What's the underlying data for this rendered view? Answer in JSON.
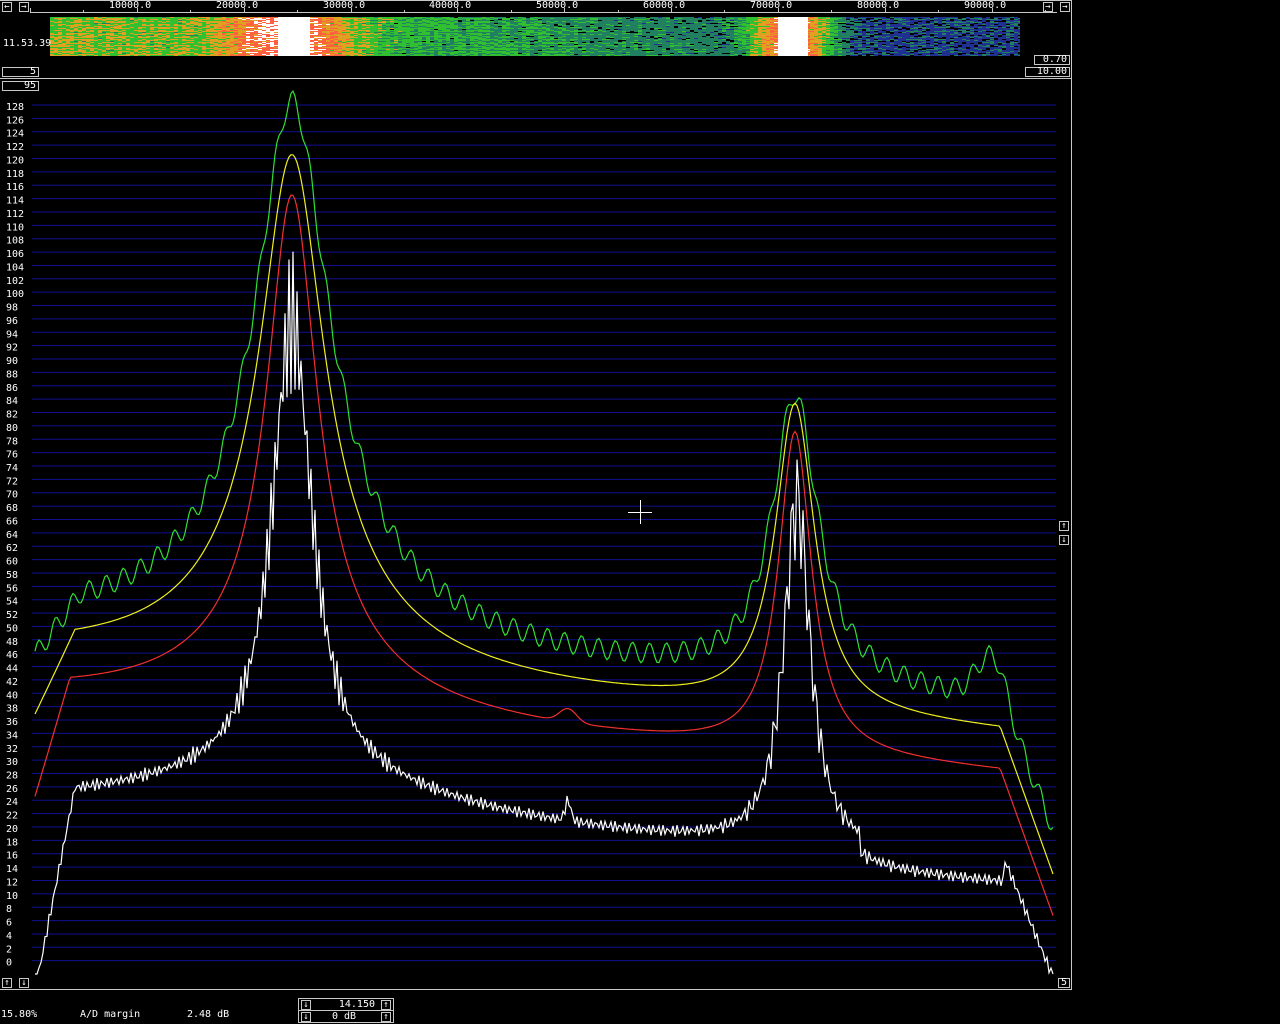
{
  "freq_axis": {
    "labels": [
      "10000.0",
      "20000.0",
      "30000.0",
      "40000.0",
      "50000.0",
      "60000.0",
      "70000.0",
      "80000.0",
      "90000.0"
    ]
  },
  "waterfall": {
    "time_label": "11.53.39",
    "gain_value": "0.70",
    "zero_value": "10.00",
    "avg_value": "5",
    "top_value": "95"
  },
  "spectrum": {
    "y_ticks": [
      "128",
      "126",
      "124",
      "122",
      "120",
      "118",
      "116",
      "114",
      "112",
      "110",
      "108",
      "106",
      "104",
      "102",
      "100",
      "98",
      "96",
      "94",
      "92",
      "90",
      "88",
      "86",
      "84",
      "82",
      "80",
      "78",
      "76",
      "74",
      "72",
      "70",
      "68",
      "66",
      "64",
      "62",
      "60",
      "58",
      "56",
      "54",
      "52",
      "50",
      "48",
      "46",
      "44",
      "42",
      "40",
      "38",
      "36",
      "34",
      "32",
      "30",
      "28",
      "26",
      "24",
      "22",
      "20",
      "18",
      "16",
      "14",
      "12",
      "10",
      "8",
      "6",
      "4",
      "2",
      "0"
    ],
    "bottom_right_value": "5"
  },
  "status": {
    "percent": "15.80%",
    "ad_margin_label": "A/D margin",
    "ad_margin_value": "2.48 dB",
    "gain_top": "14.150",
    "gain_bottom": "0 dB"
  },
  "buttons": {
    "left_arrow": "←",
    "right_arrow": "→",
    "up_arrow": "↑",
    "down_arrow": "↓"
  },
  "colors": {
    "background": "#000000",
    "grid": "#101090",
    "trace_peak": "#30e030",
    "trace_avg": "#f0f020",
    "trace_slow": "#f03030",
    "trace_current": "#ffffff",
    "frame": "#c8c8c8"
  }
}
